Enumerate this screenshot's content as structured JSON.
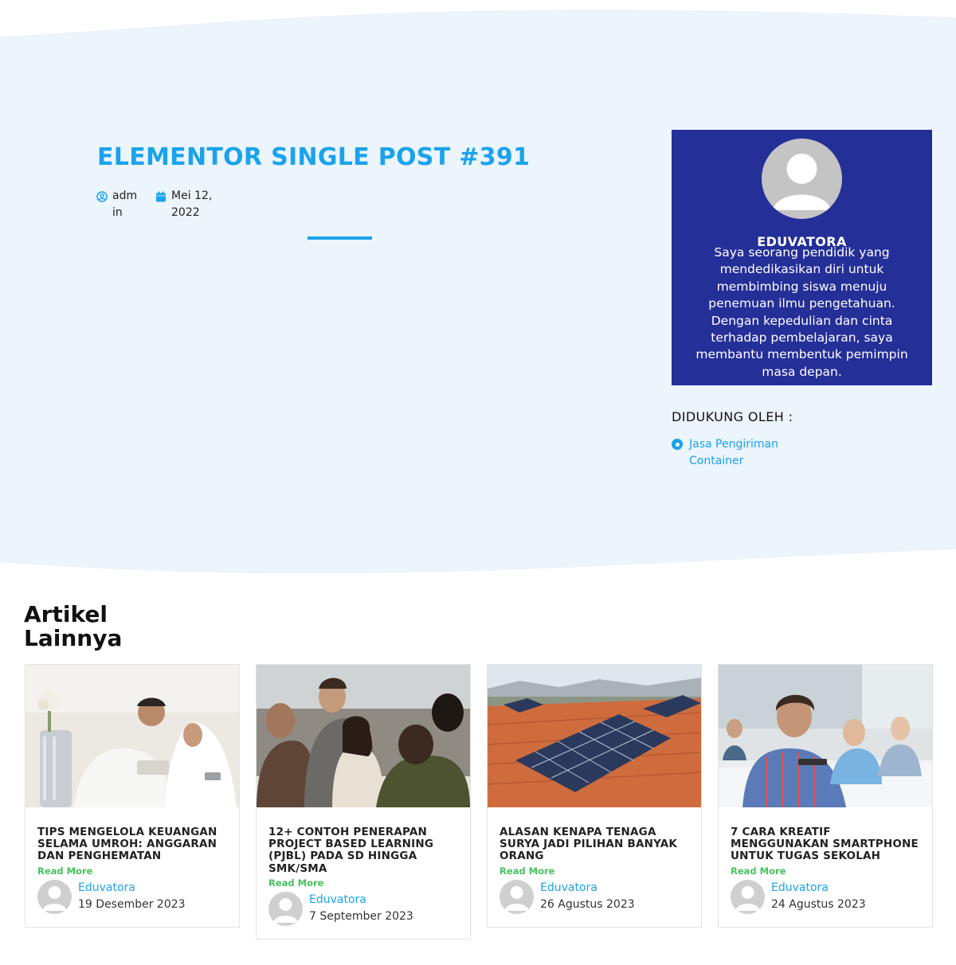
{
  "post": {
    "title": "ELEMENTOR SINGLE POST #391",
    "author": "admin",
    "date": "Mei 12, 2022"
  },
  "author_box": {
    "name": "EDUVATORA",
    "bio": "Saya seorang pendidik yang mendedikasikan diri untuk membimbing siswa menuju penemuan ilmu pengetahuan. Dengan kepedulian dan cinta terhadap pembelajaran, saya membantu membentuk pemimpin masa depan."
  },
  "supported": {
    "title": "DIDUKUNG OLEH :",
    "link": "Jasa Pengiriman Container"
  },
  "related": {
    "title": "Artikel Lainnya",
    "read_more": "Read More",
    "cards": [
      {
        "title": "TIPS MENGELOLA KEUANGAN SELAMA UMROH: ANGGARAN DAN PENGHEMATAN",
        "author": "Eduvatora",
        "date": "19 Desember 2023"
      },
      {
        "title": "12+ CONTOH PENERAPAN PROJECT BASED LEARNING (PJBL) PADA SD HINGGA SMK/SMA",
        "author": "Eduvatora",
        "date": "7 September 2023"
      },
      {
        "title": "ALASAN KENAPA TENAGA SURYA JADI PILIHAN BANYAK ORANG",
        "author": "Eduvatora",
        "date": "26 Agustus 2023"
      },
      {
        "title": "7 CARA KREATIF MENGGUNAKAN SMARTPHONE UNTUK TUGAS SEKOLAH",
        "author": "Eduvatora",
        "date": "24 Agustus 2023"
      }
    ]
  },
  "colors": {
    "accent": "#1aa3ec",
    "author_box_bg": "#252f98",
    "hero_bg": "#ecf4fc",
    "read_more": "#46c25d"
  }
}
